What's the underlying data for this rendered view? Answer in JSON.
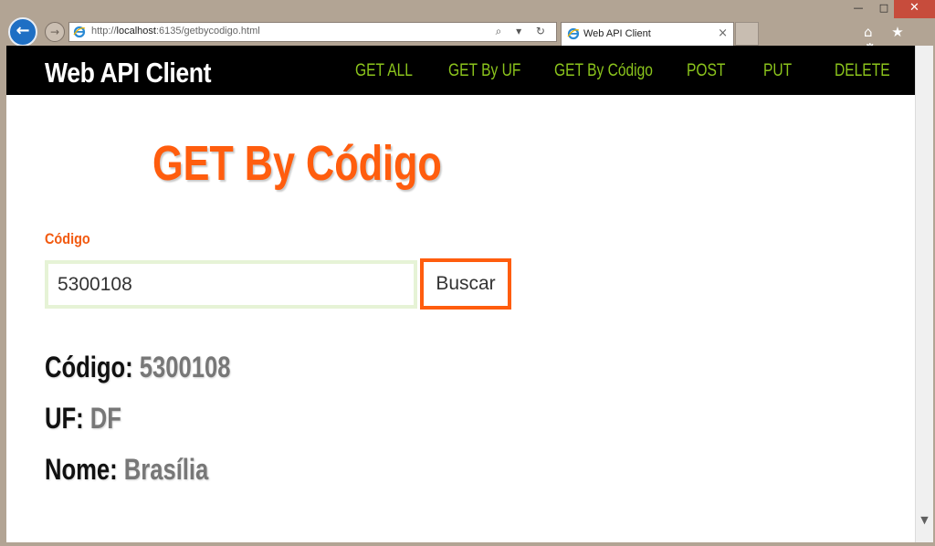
{
  "browser": {
    "address_prefix": "http://",
    "address_host": "localhost",
    "address_rest": ":6135/getbycodigo.html",
    "address_icons": "⌕ ▾ ↻",
    "tab_title": "Web API Client",
    "tab_close": "×",
    "back_glyph": "←",
    "forward_glyph": "→",
    "window_controls": {
      "minimize": "—",
      "maximize": "□",
      "close": "✕"
    },
    "tool_icons": "⌂ ★ ⚙"
  },
  "navbar": {
    "brand": "Web API Client",
    "items": [
      {
        "label": "GET ALL"
      },
      {
        "label": "GET By UF"
      },
      {
        "label": "GET By Código"
      },
      {
        "label": "POST"
      },
      {
        "label": "PUT"
      },
      {
        "label": "DELETE"
      }
    ]
  },
  "main": {
    "title": "GET By Código",
    "field_label": "Código",
    "input_value": "5300108",
    "button_label": "Buscar",
    "results": [
      {
        "key": "Código:",
        "value": "5300108"
      },
      {
        "key": "UF:",
        "value": "DF"
      },
      {
        "key": "Nome:",
        "value": "Brasília"
      }
    ]
  },
  "colors": {
    "accent": "#ff5d0e",
    "nav_link": "#8bc41c",
    "navbar_bg": "#000000",
    "result_value": "#777777"
  }
}
